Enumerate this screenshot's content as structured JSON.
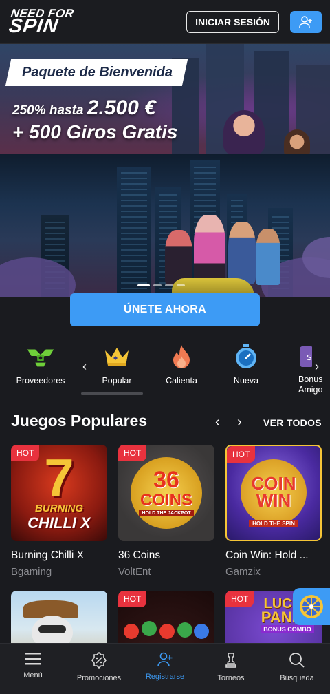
{
  "header": {
    "logo_line1": "NEED FOR",
    "logo_line2": "SPIN",
    "login_label": "INICIAR SESIÓN"
  },
  "banner": {
    "tag": "Paquete de Bienvenida",
    "line1_prefix": "250% hasta ",
    "line1_amount": "2.500 €",
    "line2": "+ 500 Giros Gratis"
  },
  "hero": {
    "cta_label": "ÚNETE AHORA",
    "slides": 4,
    "active_slide": 1
  },
  "categories": {
    "items": [
      {
        "label": "Proveedores",
        "icon": "providers-icon"
      },
      {
        "label": "Popular",
        "icon": "crown-icon"
      },
      {
        "label": "Calienta",
        "icon": "flame-icon"
      },
      {
        "label": "Nueva",
        "icon": "stopwatch-icon"
      },
      {
        "label": "Bonus Amigo",
        "icon": "bonus-icon"
      }
    ],
    "active": "Popular"
  },
  "section": {
    "title": "Juegos Populares",
    "view_all": "VER TODOS"
  },
  "games": [
    {
      "name": "Burning Chilli X",
      "provider": "Bgaming",
      "badge": "HOT",
      "art_line1": "7",
      "art_line2": "BURNING",
      "art_line3": "CHILLI X"
    },
    {
      "name": "36 Coins",
      "provider": "VoltEnt",
      "badge": "HOT",
      "art_line1": "36",
      "art_line2": "COINS",
      "art_line3": "HOLD THE JACKPOT"
    },
    {
      "name": "Coin Win: Hold ...",
      "provider": "Gamzix",
      "badge": "HOT",
      "art_line1": "COIN",
      "art_line2": "WIN",
      "art_line3": "HOLD THE SPIN"
    },
    {
      "name": "",
      "provider": "",
      "badge": "",
      "art_line1": "",
      "art_line2": "",
      "art_line3": ""
    },
    {
      "name": "",
      "provider": "",
      "badge": "HOT",
      "art_line1": "",
      "art_line2": "",
      "art_line3": ""
    },
    {
      "name": "",
      "provider": "",
      "badge": "HOT",
      "art_line1": "LUCKY",
      "art_line2": "PANDA",
      "art_line3": "BONUS COMBO"
    }
  ],
  "bottom_nav": [
    {
      "label": "Menú",
      "icon": "menu-icon"
    },
    {
      "label": "Promociones",
      "icon": "promotions-icon"
    },
    {
      "label": "Registrarse",
      "icon": "register-icon"
    },
    {
      "label": "Torneos",
      "icon": "trophy-icon"
    },
    {
      "label": "Búsqueda",
      "icon": "search-icon"
    }
  ],
  "colors": {
    "accent": "#3d9bf5",
    "hot": "#e8323e",
    "background": "#1a1b1f"
  }
}
